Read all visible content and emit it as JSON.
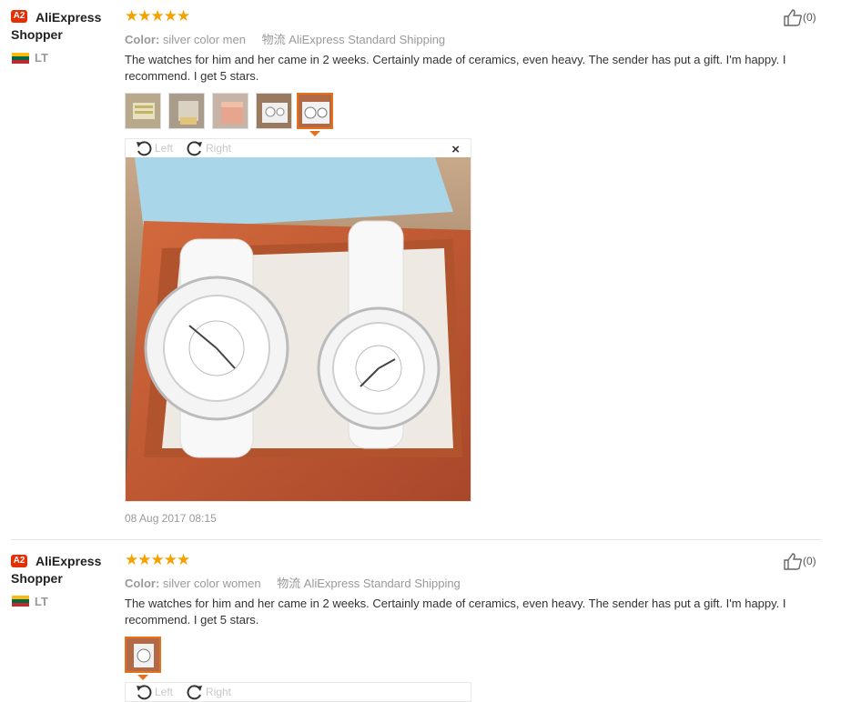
{
  "reviews": [
    {
      "badge": "A2",
      "user": "AliExpress Shopper",
      "country": "LT",
      "stars": "★★★★★",
      "color_label": "Color:",
      "color_value": "silver color men",
      "shipping": "物流 AliExpress Standard Shipping",
      "feedback": "The watches for him and her came in 2 weeks. Certainly made of ceramics, even heavy. The sender has put a gift. I'm happy. I recommend. I get 5 stars.",
      "likes": "(0)",
      "date": "08 Aug 2017 08:15",
      "viewer": {
        "left_label": "Left",
        "right_label": "Right",
        "close": "×"
      }
    },
    {
      "badge": "A2",
      "user": "AliExpress Shopper",
      "country": "LT",
      "stars": "★★★★★",
      "color_label": "Color:",
      "color_value": "silver color women",
      "shipping": "物流 AliExpress Standard Shipping",
      "feedback": "The watches for him and her came in 2 weeks. Certainly made of ceramics, even heavy. The sender has put a gift. I'm happy. I recommend. I get 5 stars.",
      "likes": "(0)",
      "viewer": {
        "left_label": "Left",
        "right_label": "Right"
      }
    }
  ],
  "colors": {
    "accent": "#e62e04",
    "star": "#f5a100",
    "selected_thumb": "#e5711d"
  },
  "flag_colors": [
    "#fdb913",
    "#006a44",
    "#c1272d"
  ]
}
